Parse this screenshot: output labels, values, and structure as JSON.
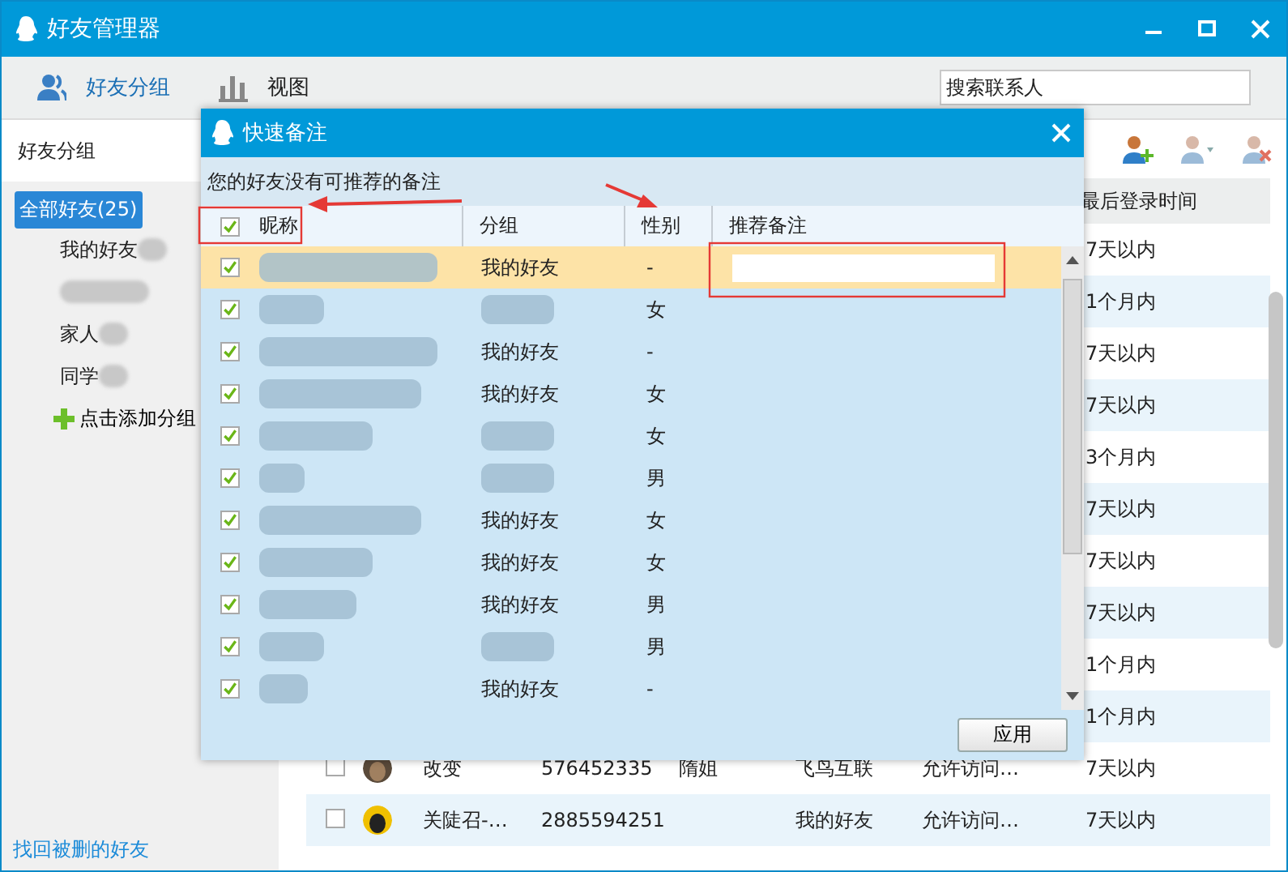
{
  "window": {
    "title": "好友管理器"
  },
  "toolbar": {
    "tabs": [
      {
        "label": "好友分组",
        "selected": true
      },
      {
        "label": "视图",
        "selected": false
      }
    ],
    "search": {
      "placeholder": "搜索联系人"
    }
  },
  "sidebar": {
    "header": "好友分组",
    "all": {
      "label": "全部好友(25)",
      "selected": true
    },
    "groups": [
      {
        "kind": "text",
        "label": "我的好友"
      },
      {
        "kind": "redacted"
      },
      {
        "kind": "text",
        "label": "家人"
      },
      {
        "kind": "text",
        "label": "同学"
      }
    ],
    "add": "点击添加分组",
    "footer_link": "找回被删的好友"
  },
  "table": {
    "columns": [
      "最后登录时间"
    ],
    "rows": [
      {
        "last_login": "7天以内"
      },
      {
        "last_login": "1个月内"
      },
      {
        "last_login": "7天以内"
      },
      {
        "last_login": "7天以内"
      },
      {
        "last_login": "3个月内"
      },
      {
        "last_login": "7天以内"
      },
      {
        "last_login": "7天以内"
      },
      {
        "last_login": "7天以内"
      },
      {
        "last_login": "1个月内"
      },
      {
        "last_login": "1个月内"
      },
      {
        "checked": false,
        "name": "改变",
        "qq": "576452335",
        "remark": "隋姐",
        "group": "飞鸟互联",
        "permission": "允许访问…",
        "last_login": "7天以内"
      },
      {
        "checked": false,
        "name": "关陡召-…",
        "qq": "2885594251",
        "group": "我的好友",
        "permission": "允许访问…",
        "last_login": "7天以内"
      }
    ]
  },
  "dialog": {
    "title": "快速备注",
    "message": "您的好友没有可推荐的备注",
    "columns": {
      "all_checked": true,
      "name": "昵称",
      "group": "分组",
      "gender": "性别",
      "remark": "推荐备注"
    },
    "rows": [
      {
        "checked": true,
        "selected": true,
        "group": "我的好友",
        "gender": "-"
      },
      {
        "checked": true,
        "selected": false,
        "gender": "女"
      },
      {
        "checked": true,
        "selected": false,
        "group": "我的好友",
        "gender": "-"
      },
      {
        "checked": true,
        "selected": false,
        "group": "我的好友",
        "gender": "女"
      },
      {
        "checked": true,
        "selected": false,
        "gender": "女"
      },
      {
        "checked": true,
        "selected": false,
        "gender": "男"
      },
      {
        "checked": true,
        "selected": false,
        "group": "我的好友",
        "gender": "女"
      },
      {
        "checked": true,
        "selected": false,
        "group": "我的好友",
        "gender": "女"
      },
      {
        "checked": true,
        "selected": false,
        "group": "我的好友",
        "gender": "男"
      },
      {
        "checked": true,
        "selected": false,
        "gender": "男"
      },
      {
        "checked": true,
        "selected": false,
        "group": "我的好友",
        "gender": "-"
      }
    ],
    "apply_button": "应用"
  }
}
